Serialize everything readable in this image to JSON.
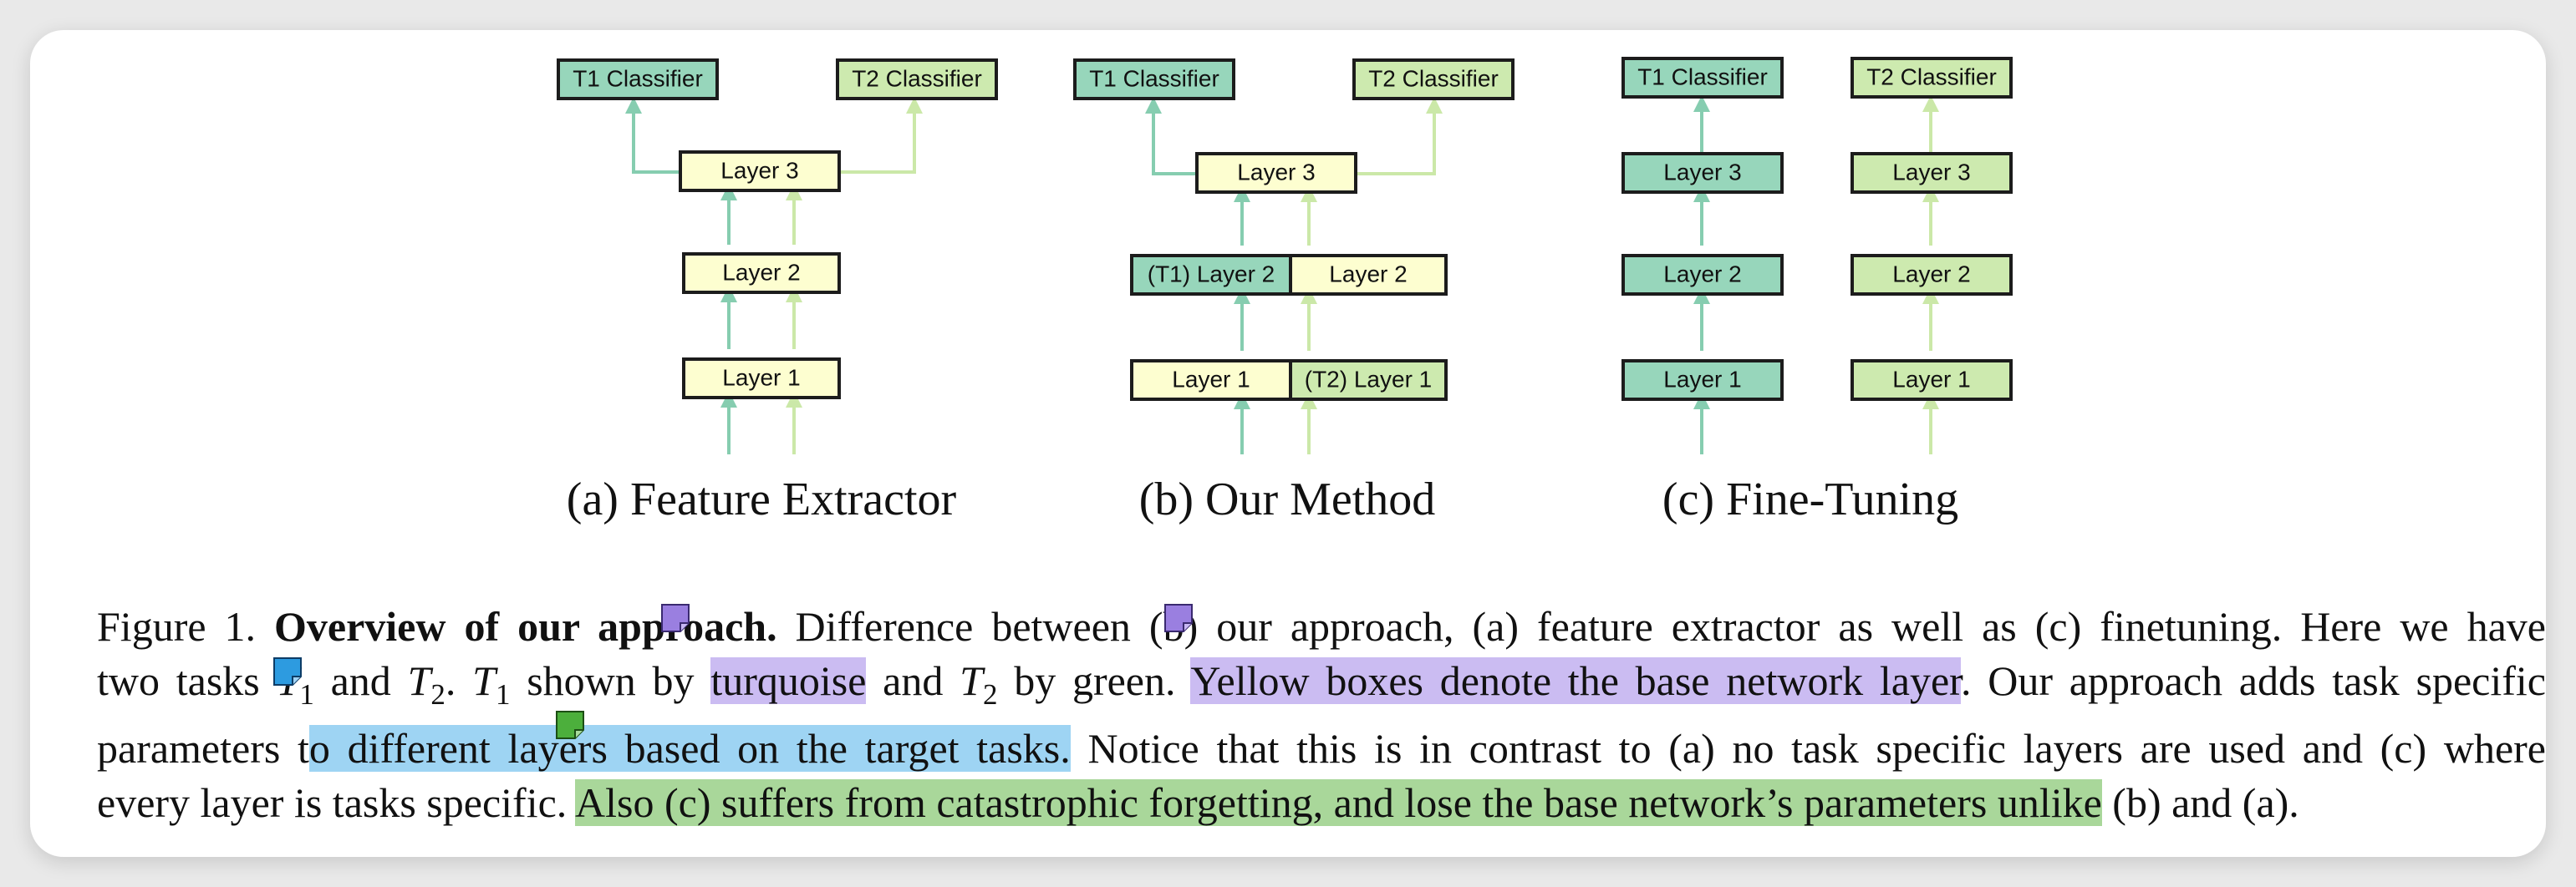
{
  "figure": {
    "panels": [
      {
        "caption": "(a) Feature Extractor",
        "classifiers": [
          "T1 Classifier",
          "T2 Classifier"
        ],
        "layers": [
          "Layer 3",
          "Layer 2",
          "Layer 1"
        ]
      },
      {
        "caption": "(b) Our Method",
        "classifiers": [
          "T1 Classifier",
          "T2 Classifier"
        ],
        "layers": [
          "Layer 3",
          "(T1) Layer 2",
          "Layer 2",
          "Layer 1",
          "(T2) Layer 1"
        ]
      },
      {
        "caption": "(c) Fine-Tuning",
        "classifiers": [
          "T1 Classifier",
          "T2 Classifier"
        ],
        "layers": [
          "Layer 3",
          "Layer 2",
          "Layer 1",
          "Layer 3",
          "Layer 2",
          "Layer 1"
        ]
      }
    ]
  },
  "caption": {
    "label": "Figure 1.",
    "title": "Overview of our approach.",
    "seg1": " Difference between (b) our approach, (a) feature extractor as well as (c) finetuning. Here we have",
    "seg2a": "two tasks ",
    "t1": "T",
    "t1_sub": "1",
    "seg2b": " and ",
    "t2": "T",
    "t2_sub": "2",
    "seg2c": ". ",
    "seg2d": " shown by ",
    "hl_turquoise": "turquoise",
    "seg2e": " and ",
    "seg2f": " by green. ",
    "hl_yellow": "Yellow boxes denote the base network layer",
    "seg2g": ". Our approach adds task specific",
    "seg3a": "parameters t",
    "hl_layers": "o different layers based on the target tasks.",
    "seg3b": " Notice that this is in contrast to (a) no task specific layers are used and (c) where",
    "seg4a": "every layer is tasks specific. ",
    "hl_also": "Also (c) suffers from catastrophic forgetting, and lose the base network’s parameters unlike",
    "seg4b": " (b) and (a)."
  },
  "colors": {
    "teal": "#97d6bb",
    "green": "#cdeaaf",
    "yellow": "#fdfed0",
    "teal_arrow": "#86cdb0",
    "green_arrow": "#cbe8a8",
    "highlight_purple": "#cbbcf2",
    "highlight_blue": "#9ed4f3",
    "highlight_green": "#a9d79a",
    "note_purple": "#9a7fe0",
    "note_blue": "#2d9be0",
    "note_green": "#4caf3c"
  },
  "annotation_icons": [
    "sticky-note-icon",
    "sticky-note-icon",
    "sticky-note-icon",
    "sticky-note-icon"
  ]
}
